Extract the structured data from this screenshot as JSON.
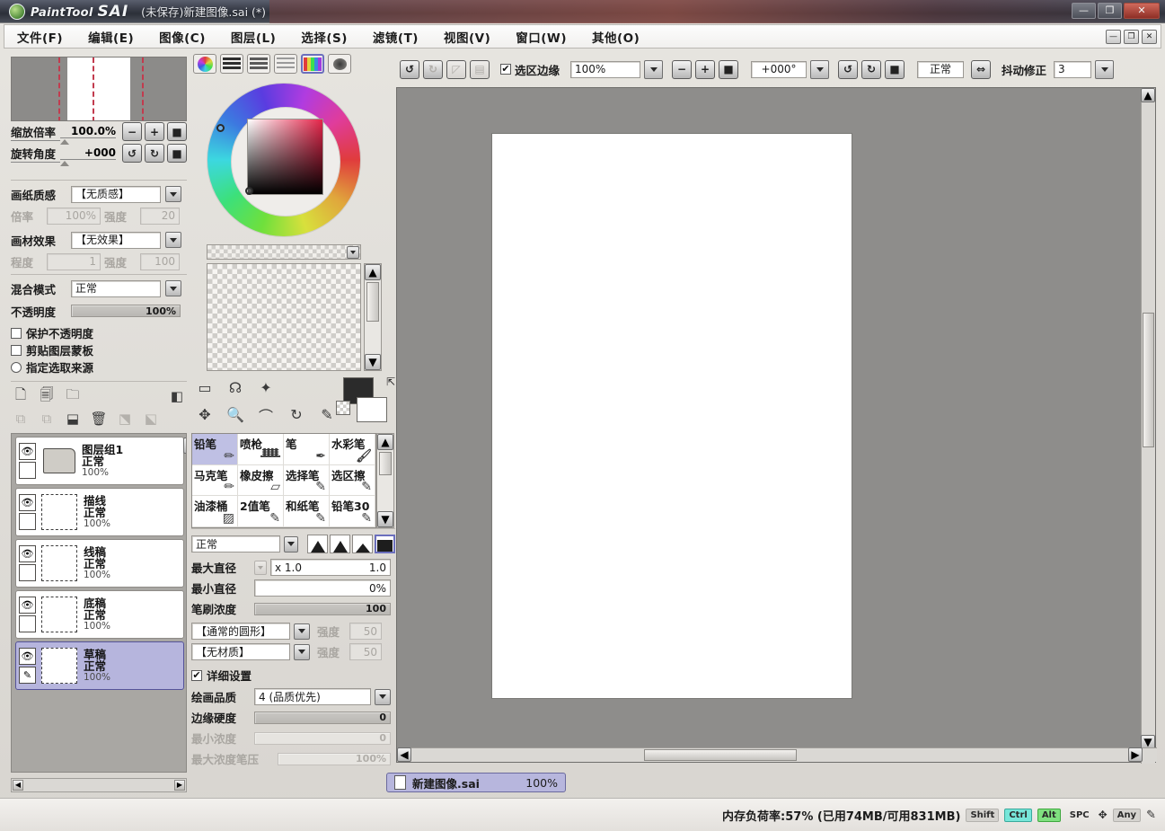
{
  "titlebar": {
    "brand_prefix": "PaintTool",
    "brand_main": "SAI",
    "document": "(未保存)新建图像.sai (*)",
    "minimize": "—",
    "maximize": "❐",
    "close": "✕"
  },
  "menubar": {
    "items": [
      {
        "label": "文件(F)"
      },
      {
        "label": "编辑(E)"
      },
      {
        "label": "图像(C)"
      },
      {
        "label": "图层(L)"
      },
      {
        "label": "选择(S)"
      },
      {
        "label": "滤镜(T)"
      },
      {
        "label": "视图(V)"
      },
      {
        "label": "窗口(W)"
      },
      {
        "label": "其他(O)"
      }
    ],
    "doc_minimize": "—",
    "doc_restore": "❐",
    "doc_close": "✕"
  },
  "navigator": {
    "zoom_label": "缩放倍率",
    "zoom_value": "100.0%",
    "rotate_label": "旋转角度",
    "rotate_value": "+000",
    "btn_zoom_out": "−",
    "btn_zoom_in": "+",
    "btn_zoom_reset": "■",
    "btn_rot_ccw": "↺",
    "btn_rot_cw": "↻",
    "btn_rot_reset": "■"
  },
  "paper_panel": {
    "texture_label": "画纸质感",
    "texture_value": "【无质感】",
    "scale_label": "倍率",
    "scale_value": "100%",
    "strength_label": "强度",
    "strength_value": "20",
    "effect_label": "画材效果",
    "effect_value": "【无效果】",
    "level_label": "程度",
    "level_value": "1",
    "effect_strength_label": "强度",
    "effect_strength_value": "100"
  },
  "layer_props": {
    "blend_label": "混合模式",
    "blend_value": "正常",
    "opacity_label": "不透明度",
    "opacity_value": "100%",
    "lock_alpha": "保护不透明度",
    "clipping_mask": "剪贴图层蒙板",
    "select_source": "指定选取来源"
  },
  "layer_toolbar": {
    "icons": [
      {
        "name": "new-layer-icon",
        "glyph": "🗋",
        "enabled": true
      },
      {
        "name": "new-linework-layer-icon",
        "glyph": "🗐",
        "enabled": true
      },
      {
        "name": "new-folder-icon",
        "glyph": "🗀",
        "enabled": true
      },
      {
        "name": "layer-mask-icon",
        "glyph": "◧",
        "enabled": true
      },
      {
        "name": "copy-layer-icon",
        "glyph": "⧉",
        "enabled": false
      },
      {
        "name": "paste-layer-icon",
        "glyph": "⧉",
        "enabled": false
      },
      {
        "name": "merge-down-icon",
        "glyph": "⬓",
        "enabled": true
      },
      {
        "name": "delete-layer-icon",
        "glyph": "🗑",
        "enabled": true
      },
      {
        "name": "transfer-icon",
        "glyph": "⬔",
        "enabled": false
      },
      {
        "name": "clear-icon",
        "glyph": "⬕",
        "enabled": false
      }
    ]
  },
  "layers": [
    {
      "name": "图层组1",
      "mode": "正常",
      "opacity": "100%",
      "type": "group",
      "selected": false,
      "visible": true
    },
    {
      "name": "描线",
      "mode": "正常",
      "opacity": "100%",
      "type": "layer",
      "selected": false,
      "visible": true
    },
    {
      "name": "线稿",
      "mode": "正常",
      "opacity": "100%",
      "type": "layer",
      "selected": false,
      "visible": true
    },
    {
      "name": "底稿",
      "mode": "正常",
      "opacity": "100%",
      "type": "layer",
      "selected": false,
      "visible": true
    },
    {
      "name": "草稿",
      "mode": "正常",
      "opacity": "100%",
      "type": "layer",
      "selected": true,
      "visible": true
    }
  ],
  "color_panel": {
    "tabs": [
      {
        "name": "color-wheel-tab",
        "selected": false
      },
      {
        "name": "rgb-sliders-tab",
        "selected": false
      },
      {
        "name": "hsv-sliders-tab",
        "selected": false
      },
      {
        "name": "gradient-tab",
        "selected": false
      },
      {
        "name": "palette-tab",
        "selected": true
      },
      {
        "name": "scratchpad-tab",
        "selected": false
      }
    ]
  },
  "tools": {
    "row1": [
      {
        "name": "rect-select-tool",
        "glyph": "▭"
      },
      {
        "name": "lasso-select-tool",
        "glyph": "☊"
      },
      {
        "name": "magic-wand-tool",
        "glyph": "✦"
      }
    ],
    "row2": [
      {
        "name": "move-tool",
        "glyph": "✥"
      },
      {
        "name": "zoom-tool",
        "glyph": "🔍"
      },
      {
        "name": "rotate-tool",
        "glyph": "⌒"
      },
      {
        "name": "hand-tool",
        "glyph": "↻"
      },
      {
        "name": "eyedropper-tool",
        "glyph": "✎"
      }
    ],
    "swap_icon": "⇱"
  },
  "brushes": [
    {
      "label": "铅笔",
      "glyph": "✏",
      "selected": true
    },
    {
      "label": "喷枪",
      "glyph": "ᚙ",
      "selected": false
    },
    {
      "label": "笔",
      "glyph": "✒",
      "selected": false
    },
    {
      "label": "水彩笔",
      "glyph": "🖌",
      "selected": false
    },
    {
      "label": "马克笔",
      "glyph": "✏",
      "selected": false
    },
    {
      "label": "橡皮擦",
      "glyph": "▱",
      "selected": false
    },
    {
      "label": "选择笔",
      "glyph": "✎",
      "selected": false
    },
    {
      "label": "选区擦",
      "glyph": "✎",
      "selected": false
    },
    {
      "label": "油漆桶",
      "glyph": "▨",
      "selected": false
    },
    {
      "label": "2值笔",
      "glyph": "✎",
      "selected": false
    },
    {
      "label": "和纸笔",
      "glyph": "✎",
      "selected": false
    },
    {
      "label": "铅笔30",
      "glyph": "✎",
      "selected": false
    }
  ],
  "brush_settings": {
    "blend_mode": "正常",
    "max_diameter_label": "最大直径",
    "max_diameter_mult": "x 1.0",
    "max_diameter_value": "1.0",
    "min_diameter_label": "最小直径",
    "min_diameter_value": "0%",
    "density_label": "笔刷浓度",
    "density_value": "100",
    "shape_value": "【通常的圆形】",
    "shape_strength_label": "强度",
    "shape_strength_value": "50",
    "texture_value": "【无材质】",
    "texture_strength_label": "强度",
    "texture_strength_value": "50",
    "detail_settings": "详细设置",
    "quality_label": "绘画品质",
    "quality_value": "4 (品质优先)",
    "edge_hardness_label": "边缘硬度",
    "edge_hardness_value": "0",
    "min_density_label": "最小浓度",
    "min_density_value": "0",
    "max_density_press_label": "最大浓度笔压",
    "max_density_press_value": "100%"
  },
  "canvas_toolbar": {
    "undo": "↺",
    "redo": "↻",
    "btn3": "◸",
    "btn4": "▤",
    "selection_edge_label": "选区边缘",
    "selection_edge_checked": true,
    "zoom_value": "100%",
    "zoom_out": "−",
    "zoom_in": "+",
    "zoom_reset": "■",
    "rotate_value": "+000°",
    "rot_ccw": "↺",
    "rot_cw": "↻",
    "rot_reset": "■",
    "flip_mode": "正常",
    "flip_btn": "⇔",
    "stabilizer_label": "抖动修正",
    "stabilizer_value": "3"
  },
  "document_tab": {
    "filename": "新建图像.sai",
    "zoom": "100%"
  },
  "statusbar": {
    "memory_text": "内存负荷率:57% (已用74MB/可用831MB)",
    "keys": [
      {
        "label": "Shift",
        "state": "off"
      },
      {
        "label": "Ctrl",
        "state": "on"
      },
      {
        "label": "Alt",
        "state": "green"
      },
      {
        "label": "SPC",
        "state": "off"
      }
    ],
    "nav_icon": "✥",
    "any_label": "Any",
    "pen_icon": "✎"
  },
  "colors": {
    "title_dark": "#2c3038",
    "title_red": "#8f2f26",
    "selection_purple": "#b6b5dd",
    "panel_bg": "#e7e5e0",
    "canvas_gray": "#8e8d8b",
    "foreground": "#2b2b2b",
    "background": "#ffffff"
  }
}
